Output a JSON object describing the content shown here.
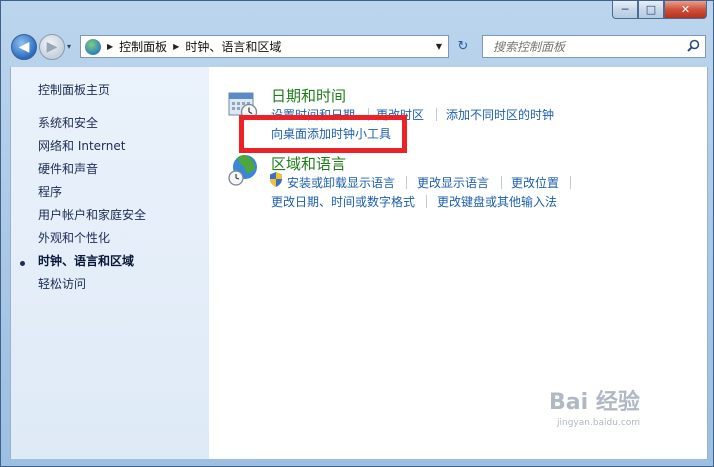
{
  "window": {
    "caption": {
      "minimize": "─",
      "maximize": "□",
      "close": "✕"
    }
  },
  "nav": {
    "back_glyph": "◀",
    "forward_glyph": "▶",
    "recent_glyph": "▾",
    "breadcrumbs": [
      "控制面板",
      "时钟、语言和区域"
    ],
    "crumb_arrow": "▶",
    "address_drop": "▼",
    "refresh_glyph": "↻"
  },
  "search": {
    "placeholder": "搜索控制面板",
    "icon": "search-icon"
  },
  "sidebar": {
    "items": [
      {
        "label": "控制面板主页"
      },
      {
        "label": "系统和安全"
      },
      {
        "label": "网络和 Internet"
      },
      {
        "label": "硬件和声音"
      },
      {
        "label": "程序"
      },
      {
        "label": "用户帐户和家庭安全"
      },
      {
        "label": "外观和个性化"
      },
      {
        "label": "时钟、语言和区域",
        "active": true
      },
      {
        "label": "轻松访问"
      }
    ]
  },
  "main": {
    "date_time": {
      "title": "日期和时间",
      "links": [
        "设置时间和日期",
        "更改时区",
        "添加不同时区的时钟",
        "向桌面添加时钟小工具"
      ]
    },
    "region_language": {
      "title": "区域和语言",
      "links": [
        "安装或卸载显示语言",
        "更改显示语言",
        "更改位置",
        "更改日期、时间或数字格式",
        "更改键盘或其他输入法"
      ]
    }
  },
  "watermark": {
    "text": "Bai 经验",
    "sub": "jingyan.baidu.com"
  },
  "colors": {
    "highlight": "#ec2227",
    "category_title": "#1f7d1a",
    "link": "#1c5fb0"
  }
}
